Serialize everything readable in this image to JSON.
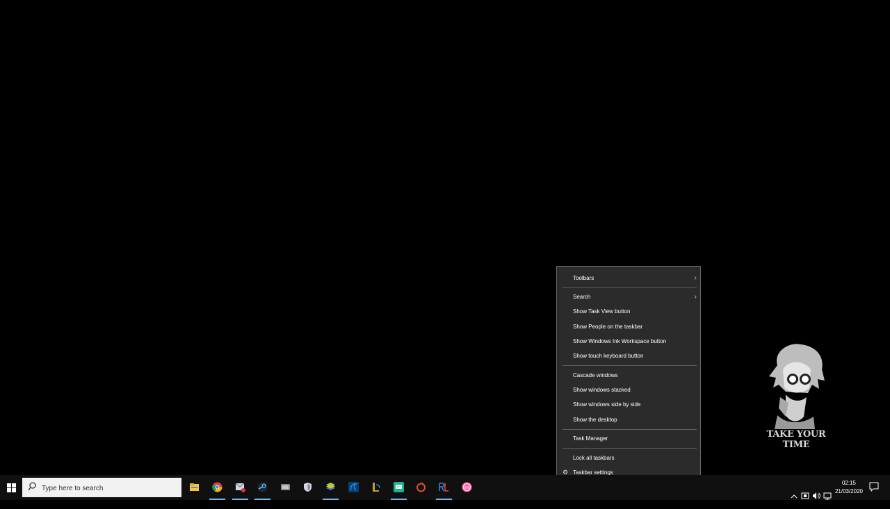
{
  "context_menu": {
    "items": [
      {
        "label": "Toolbars",
        "submenu": true
      },
      {
        "label": "Search",
        "submenu": true
      },
      {
        "label": "Show Task View button"
      },
      {
        "label": "Show People on the taskbar"
      },
      {
        "label": "Show Windows Ink Workspace button"
      },
      {
        "label": "Show touch keyboard button"
      },
      {
        "label": "Cascade windows"
      },
      {
        "label": "Show windows stacked"
      },
      {
        "label": "Show windows side by side"
      },
      {
        "label": "Show the desktop"
      },
      {
        "label": "Task Manager"
      },
      {
        "label": "Lock all taskbars"
      },
      {
        "label": "Taskbar settings",
        "icon": "gear-icon"
      }
    ]
  },
  "wallpaper": {
    "caption": "TAKE YOUR TIME"
  },
  "taskbar": {
    "search_placeholder": "Type here to search",
    "apps": [
      {
        "name": "file-explorer-icon",
        "color": "#f5c542"
      },
      {
        "name": "chrome-icon",
        "color": "#4285f4"
      },
      {
        "name": "mail-icon",
        "color": "#d23b3b"
      },
      {
        "name": "steam-icon",
        "color": "#66c0f4"
      },
      {
        "name": "hardware-app-icon",
        "color": "#c8c8c8"
      },
      {
        "name": "shield-app-icon",
        "color": "#d9d9d9"
      },
      {
        "name": "bluestacks-icon",
        "color": "#a6d13a"
      },
      {
        "name": "battlenet-icon",
        "color": "#148eff"
      },
      {
        "name": "league-client-icon",
        "color": "#1a9fd6"
      },
      {
        "name": "chat-app-icon",
        "color": "#1ab394"
      },
      {
        "name": "origin-icon",
        "color": "#e54b2c"
      },
      {
        "name": "rl-app-icon",
        "color": "#e04b3a"
      },
      {
        "name": "osu-icon",
        "color": "#ff66aa"
      }
    ],
    "clock": {
      "time": "02:15",
      "date": "21/03/2020"
    }
  }
}
